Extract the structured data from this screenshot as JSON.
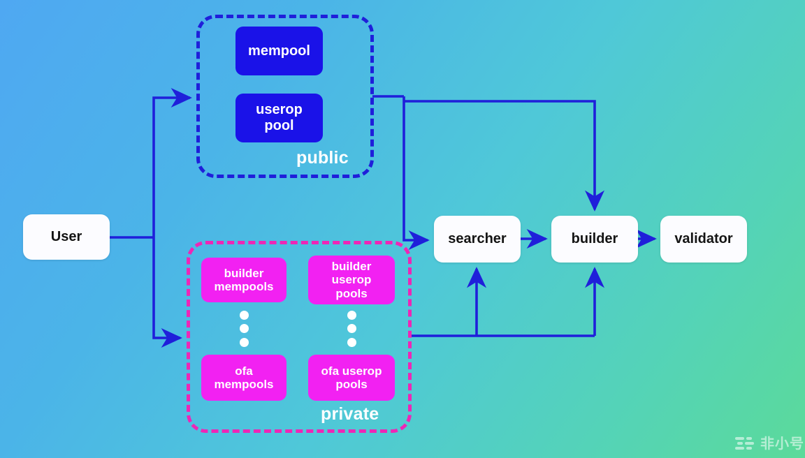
{
  "diagram": {
    "title": "mempool and userop pool flow to searcher, builder, validator",
    "background": {
      "from": "#4FA8F2",
      "to": "#5BDA9A"
    },
    "colors": {
      "wire": "#1F1FDA",
      "public_border": "#1F1FDA",
      "private_border": "#EE26B6",
      "blue_node": "#1A12E8",
      "magenta_node": "#F221F2",
      "white_node": "#FCFCFF"
    },
    "nodes": {
      "user": "User",
      "mempool": "mempool",
      "userop_pool": "userop\npool",
      "userop_pool_line1": "userop",
      "userop_pool_line2": "pool",
      "builder_mempools_line1": "builder",
      "builder_mempools_line2": "mempools",
      "builder_userop_pools_line1": "builder",
      "builder_userop_pools_line2": "userop",
      "builder_userop_pools_line3": "pools",
      "ofa_mempools_line1": "ofa",
      "ofa_mempools_line2": "mempools",
      "ofa_userop_pools_line1": "ofa userop",
      "ofa_userop_pools_line2": "pools",
      "searcher": "searcher",
      "builder": "builder",
      "validator": "validator"
    },
    "groups": {
      "public_label": "public",
      "private_label": "private"
    },
    "watermark": {
      "text": "非小号"
    }
  }
}
